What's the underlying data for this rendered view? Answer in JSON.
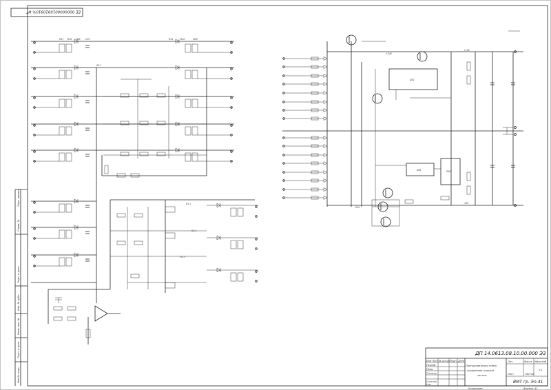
{
  "stamp": {
    "top_left": "ЕЕ 0000000016910910% ИТ"
  },
  "title_block": {
    "doc_code": "ДП 14.0613.08.10.00.000 ЭЗ",
    "title_line1": "Принципиальная схема",
    "title_line2": "управления силовой",
    "title_line3": "частью",
    "col_lit": "Лит.",
    "col_mass": "Масса",
    "col_scale": "Масштаб",
    "sheet_label": "Лист",
    "sheets_label": "Листов",
    "scale_value": "1:1",
    "group": "ВМТ гр. Эл-41",
    "rows": [
      "Изм Лист",
      "№ докум.",
      "Подп.",
      "Дата",
      "Разраб.",
      "Пров.",
      "Т.контр.",
      "Н.контр.",
      "Утв."
    ],
    "copied": "Копировал",
    "format": "Формат А1"
  },
  "side_strip": {
    "cells": [
      "Инв.№ подл.",
      "Подп. и дата",
      "Взам. инв. №",
      "Инв. № дубл.",
      "Подп. и дата",
      "Справ. №",
      "Перв. примен."
    ]
  },
  "labels": {
    "left_top": [
      "R17",
      "R18",
      "VD5",
      "C19",
      "X5.1",
      "R41",
      "R42",
      "VD8"
    ],
    "net_plus15": "+15V",
    "net_minus15": "-15V",
    "net_plus24": "+24V",
    "net_minus24": "-24V",
    "mid_k1": "К1.1",
    "mid_k2": "К1.2",
    "mid_k3": "К1.3",
    "ic1": "DD1",
    "ic2": "DA1",
    "ic3": "DA2"
  }
}
